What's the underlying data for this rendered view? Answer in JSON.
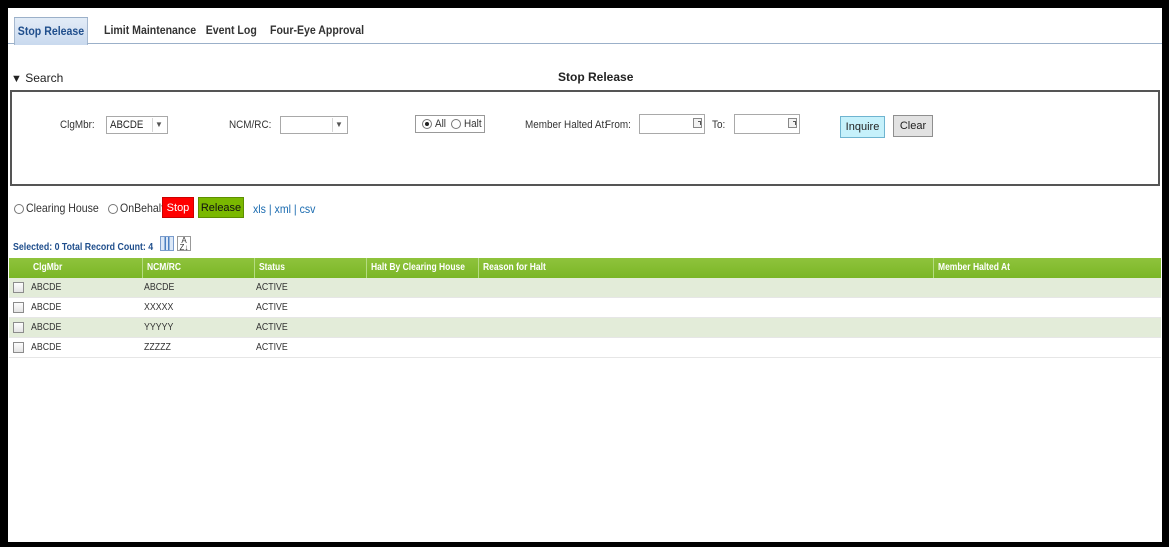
{
  "tabs": [
    {
      "label": "Stop Release",
      "active": true
    },
    {
      "label": "Limit Maintenance",
      "active": false
    },
    {
      "label": "Event Log",
      "active": false
    },
    {
      "label": "Four-Eye Approval",
      "active": false
    }
  ],
  "search": {
    "toggle_label": "Search",
    "toggle_icon": "triangle-down-icon",
    "title": "Stop Release",
    "clg_mbr_label": "ClgMbr:",
    "clg_mbr_value": "ABCDE",
    "ncm_rc_label": "NCM/RC:",
    "ncm_rc_value": "",
    "status_options": [
      {
        "label": "All",
        "selected": true
      },
      {
        "label": "Halt",
        "selected": false
      }
    ],
    "member_halted_label": "Member Halted At:",
    "from_label": "From:",
    "from_value": "",
    "to_label": "To:",
    "to_value": "",
    "inquire_label": "Inquire",
    "clear_label": "Clear"
  },
  "actions": {
    "clearing_house_label": "Clearing House",
    "on_behalf_label": "OnBehalf",
    "stop_label": "Stop",
    "release_label": "Release",
    "export": {
      "xls": "xls",
      "sep1": " | ",
      "xml": "xml",
      "sep2": " | ",
      "csv": "csv"
    }
  },
  "grid": {
    "record_count_text": "Selected: 0 Total Record Count: 4",
    "columns": [
      "ClgMbr",
      "NCM/RC",
      "Status",
      "Halt By Clearing House",
      "Reason for Halt",
      "Member Halted At"
    ],
    "rows": [
      {
        "clg_mbr": "ABCDE",
        "ncm_rc": "ABCDE",
        "status": "ACTIVE",
        "halt_by_ch": "",
        "reason": "",
        "halted_at": ""
      },
      {
        "clg_mbr": "ABCDE",
        "ncm_rc": "XXXXX",
        "status": "ACTIVE",
        "halt_by_ch": "",
        "reason": "",
        "halted_at": ""
      },
      {
        "clg_mbr": "ABCDE",
        "ncm_rc": "YYYYY",
        "status": "ACTIVE",
        "halt_by_ch": "",
        "reason": "",
        "halted_at": ""
      },
      {
        "clg_mbr": "ABCDE",
        "ncm_rc": "ZZZZZ",
        "status": "ACTIVE",
        "halt_by_ch": "",
        "reason": "",
        "halted_at": ""
      }
    ]
  },
  "colors": {
    "header_green": "#7ab626",
    "row_alt": "#e3ecd9",
    "stop_red": "#ff0000",
    "release_green": "#7ab800",
    "link_blue": "#1a6bb0"
  }
}
